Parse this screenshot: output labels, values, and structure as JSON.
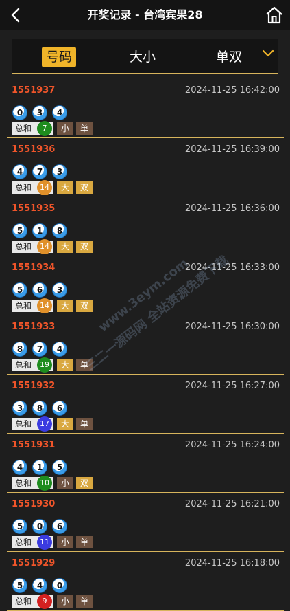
{
  "header": {
    "title": "开奖记录 - 台湾宾果28",
    "back_icon": "chevron-left-icon",
    "home_icon": "home-icon"
  },
  "tabs": [
    {
      "label": "号码",
      "active": true
    },
    {
      "label": "大小",
      "active": false
    },
    {
      "label": "单双",
      "active": false
    }
  ],
  "tabs_more_icon": "chevron-down-icon",
  "sum_label": "总和",
  "colors": {
    "accent": "#f0b429",
    "issue": "#f0552a",
    "divider": "#d7b45c",
    "sum_green": "#1e8c1e",
    "sum_orange": "#e0902a",
    "sum_blue": "#3b3be0",
    "sum_red": "#d42020",
    "tag_small_odd": "#6e5240",
    "tag_big_even": "#d9a840"
  },
  "records": [
    {
      "issue": "1551937",
      "time": "2024-11-25 16:42:00",
      "numbers": [
        "0",
        "3",
        "4"
      ],
      "sum": "7",
      "sum_color": "green",
      "size": "小",
      "parity": "单"
    },
    {
      "issue": "1551936",
      "time": "2024-11-25 16:39:00",
      "numbers": [
        "4",
        "7",
        "3"
      ],
      "sum": "14",
      "sum_color": "orange",
      "size": "大",
      "parity": "双"
    },
    {
      "issue": "1551935",
      "time": "2024-11-25 16:36:00",
      "numbers": [
        "5",
        "1",
        "8"
      ],
      "sum": "14",
      "sum_color": "orange",
      "size": "大",
      "parity": "双"
    },
    {
      "issue": "1551934",
      "time": "2024-11-25 16:33:00",
      "numbers": [
        "5",
        "6",
        "3"
      ],
      "sum": "14",
      "sum_color": "orange",
      "size": "大",
      "parity": "双"
    },
    {
      "issue": "1551933",
      "time": "2024-11-25 16:30:00",
      "numbers": [
        "8",
        "7",
        "4"
      ],
      "sum": "19",
      "sum_color": "green",
      "size": "大",
      "parity": "单"
    },
    {
      "issue": "1551932",
      "time": "2024-11-25 16:27:00",
      "numbers": [
        "3",
        "8",
        "6"
      ],
      "sum": "17",
      "sum_color": "blue",
      "size": "大",
      "parity": "单"
    },
    {
      "issue": "1551931",
      "time": "2024-11-25 16:24:00",
      "numbers": [
        "4",
        "1",
        "5"
      ],
      "sum": "10",
      "sum_color": "green",
      "size": "小",
      "parity": "双"
    },
    {
      "issue": "1551930",
      "time": "2024-11-25 16:21:00",
      "numbers": [
        "5",
        "0",
        "6"
      ],
      "sum": "11",
      "sum_color": "blue",
      "size": "小",
      "parity": "单"
    },
    {
      "issue": "1551929",
      "time": "2024-11-25 16:18:00",
      "numbers": [
        "5",
        "4",
        "0"
      ],
      "sum": "9",
      "sum_color": "red",
      "size": "小",
      "parity": "单"
    }
  ],
  "watermark": {
    "line1": "www.3eym.com",
    "line2": "三二一源码网 全站资源免费下载"
  }
}
